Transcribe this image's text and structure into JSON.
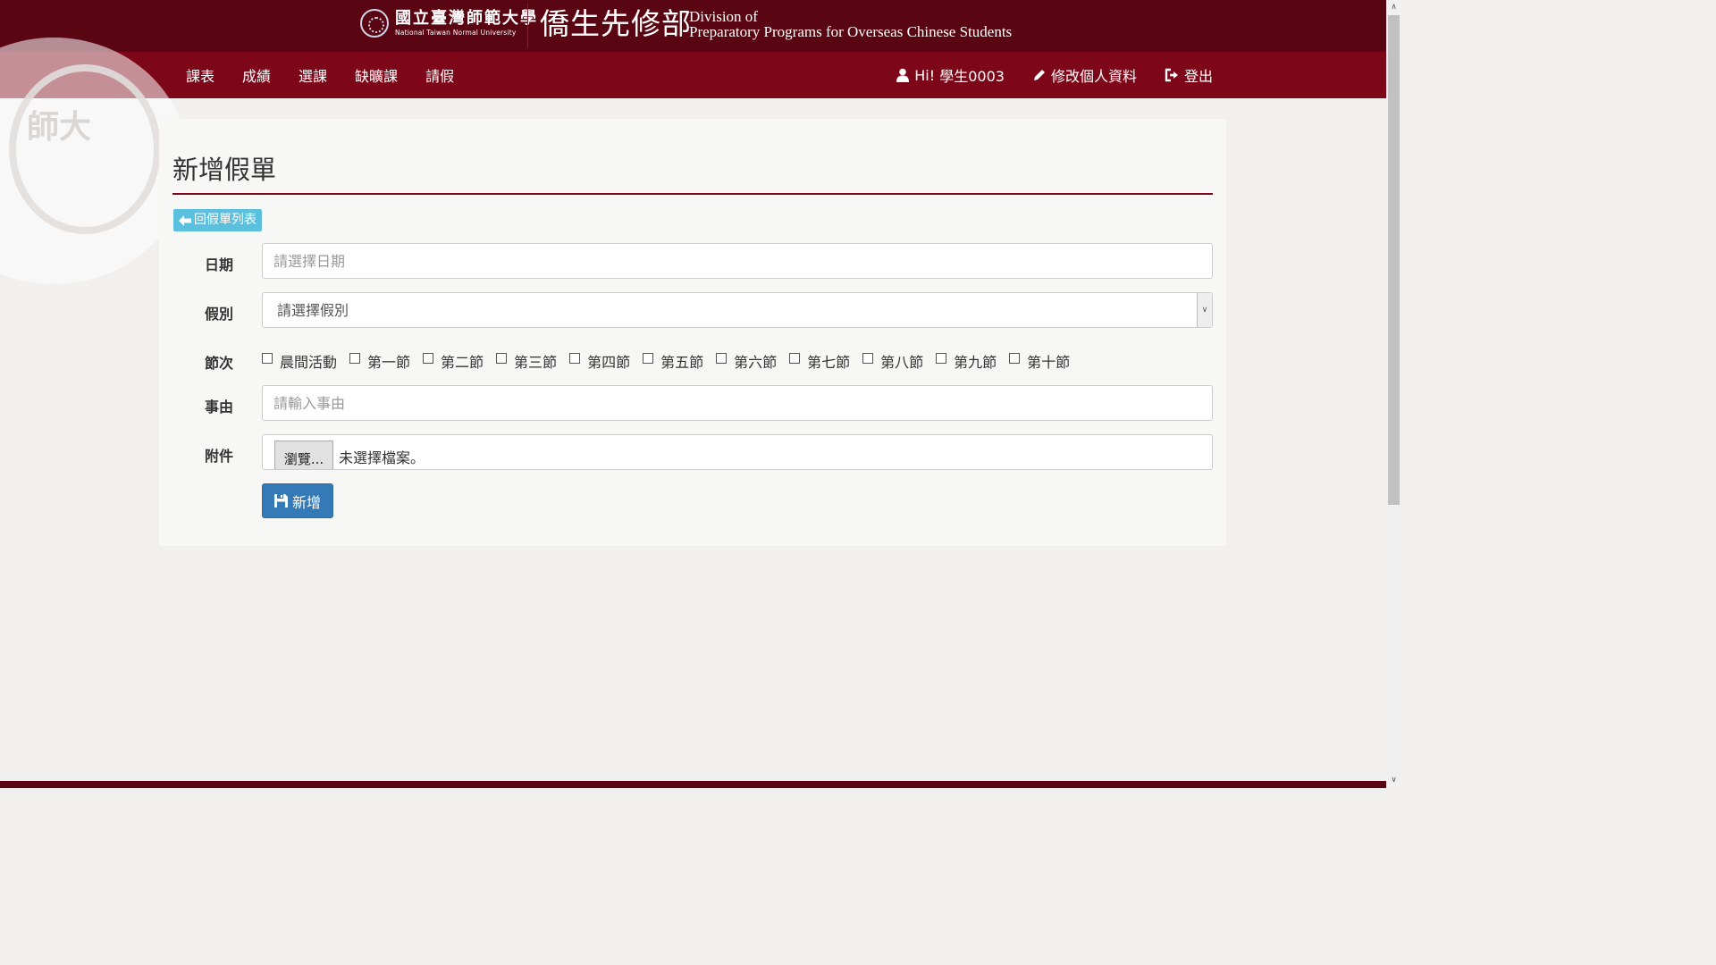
{
  "header": {
    "university_cn": "國立臺灣師範大學",
    "university_en": "National Taiwan Normal University",
    "department_cn": "僑生先修部",
    "department_en_line1": "Division of",
    "department_en_line2": "Preparatory Programs for Overseas Chinese Students",
    "brand_color": "#5a0612"
  },
  "nav": {
    "items": [
      "課表",
      "成績",
      "選課",
      "缺曠課",
      "請假"
    ],
    "user_greeting": "Hi!",
    "user_name": "學生0003",
    "edit_profile": "修改個人資料",
    "logout": "登出",
    "bar_color": "#7d0718",
    "icons": {
      "user": "user-icon",
      "edit": "pencil-icon",
      "logout": "logout-icon"
    }
  },
  "watermark": {
    "text": "師大"
  },
  "page": {
    "title": "新增假單",
    "back_button": "回假單列表"
  },
  "form": {
    "date_label": "日期",
    "date_placeholder": "請選擇日期",
    "type_label": "假別",
    "type_selected": "請選擇假別",
    "periods_label": "節次",
    "periods": [
      "晨間活動",
      "第一節",
      "第二節",
      "第三節",
      "第四節",
      "第五節",
      "第六節",
      "第七節",
      "第八節",
      "第九節",
      "第十節"
    ],
    "reason_label": "事由",
    "reason_placeholder": "請輸入事由",
    "attachment_label": "附件",
    "browse_button": "瀏覽...",
    "no_file": "未選擇檔案。",
    "submit_button": "新增",
    "submit_color": "#337ab7",
    "back_button_color": "#5bc0de"
  }
}
